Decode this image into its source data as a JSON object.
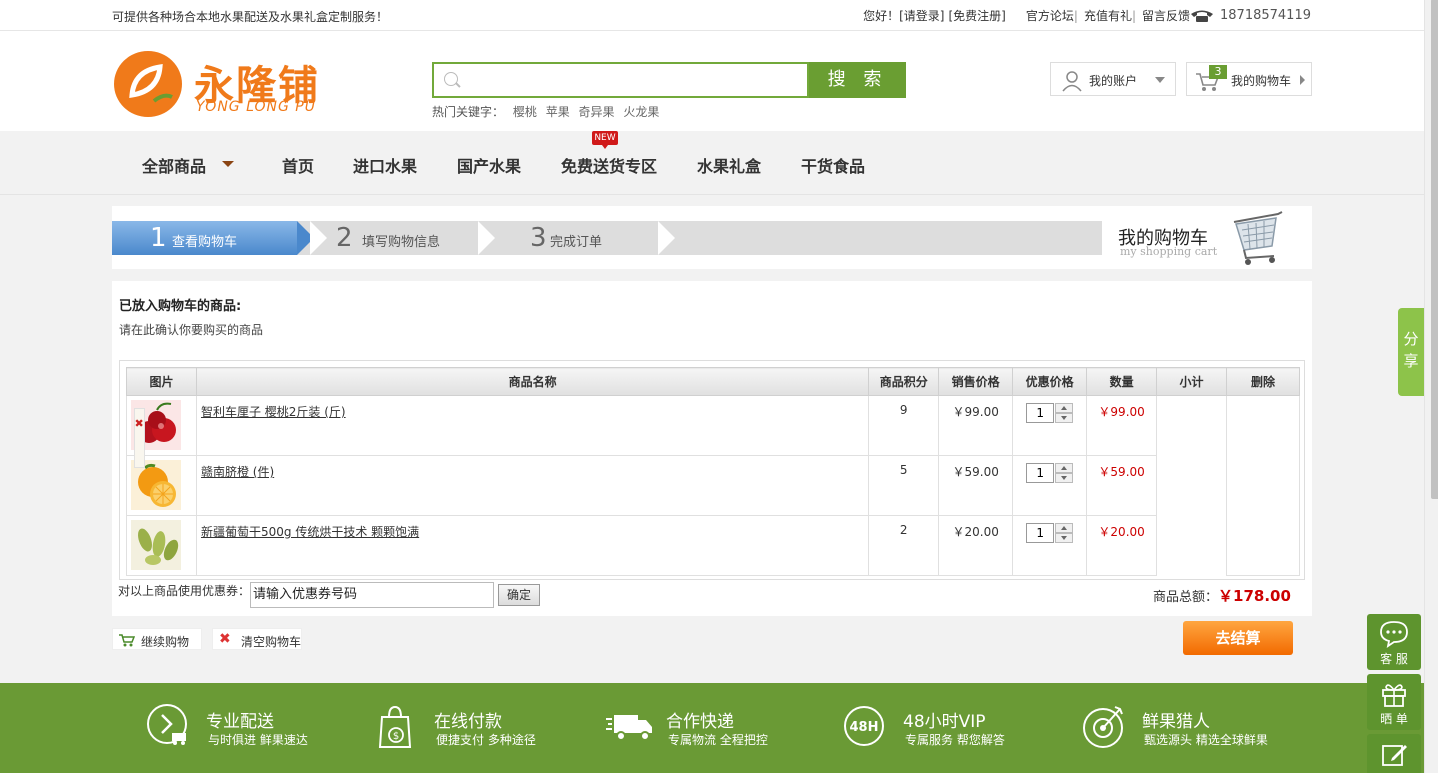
{
  "topbar": {
    "message": "可提供各种场合本地水果配送及水果礼盒定制服务！",
    "greeting": "您好！",
    "login": "[请登录]",
    "register": "[免费注册]",
    "forum": "官方论坛",
    "recharge": "充值有礼",
    "feedback": "留言反馈",
    "phone": "18718574119"
  },
  "logo": {
    "cn": "永隆铺",
    "en": "YONG LONG PU"
  },
  "search": {
    "button": "搜 索",
    "hot_label": "热门关键字：",
    "hot_words": [
      "樱桃",
      "苹果",
      "奇异果",
      "火龙果"
    ]
  },
  "account": {
    "label": "我的账户"
  },
  "cart": {
    "label": "我的购物车",
    "count": "3"
  },
  "nav": {
    "all": "全部商品",
    "items": [
      "首页",
      "进口水果",
      "国产水果",
      "免费送货专区",
      "水果礼盒",
      "干货食品"
    ],
    "new_badge": "NEW"
  },
  "steps": [
    {
      "num": "1",
      "label": "查看购物车"
    },
    {
      "num": "2",
      "label": "填写购物信息"
    },
    {
      "num": "3",
      "label": "完成订单"
    }
  ],
  "mycart": {
    "title": "我的购物车",
    "subtitle": "my shopping cart"
  },
  "content": {
    "heading": "已放入购物车的商品:",
    "subheading": "请在此确认你要购买的商品",
    "columns": [
      "图片",
      "商品名称",
      "商品积分",
      "销售价格",
      "优惠价格",
      "数量",
      "小计",
      "删除"
    ],
    "rows": [
      {
        "name": "智利车厘子 樱桃2斤装 (斤)",
        "points": "9",
        "price": "￥99.00",
        "qty": "1",
        "subtotal": "￥99.00",
        "del": "✖"
      },
      {
        "name": "赣南脐橙 (件)",
        "points": "5",
        "price": "￥59.00",
        "qty": "1",
        "subtotal": "￥59.00",
        "del": "✖"
      },
      {
        "name": "新疆葡萄干500g 传统烘干技术 颗颗饱满",
        "points": "2",
        "price": "￥20.00",
        "qty": "1",
        "subtotal": "￥20.00",
        "del": "✖"
      }
    ],
    "coupon_label": "对以上商品使用优惠券：",
    "coupon_placeholder": "请输入优惠券号码",
    "coupon_button": "确定",
    "total_label": "商品总额：",
    "total_value": "￥178.00"
  },
  "actions": {
    "continue": "继续购物",
    "clear": "清空购物车",
    "checkout": "去结算"
  },
  "features": [
    {
      "title": "专业配送",
      "sub": "与时俱进 鲜果速达",
      "icon": "delivery-icon"
    },
    {
      "title": "在线付款",
      "sub": "便捷支付 多种途径",
      "icon": "payment-icon"
    },
    {
      "title": "合作快递",
      "sub": "专属物流 全程把控",
      "icon": "truck-icon"
    },
    {
      "title": "48小时VIP",
      "sub": "专属服务 帮您解答",
      "icon": "48h-icon"
    },
    {
      "title": "鲜果猎人",
      "sub": "甄选源头 精选全球鲜果",
      "icon": "target-icon"
    }
  ],
  "float": {
    "share": "分享",
    "service": "客 服",
    "show": "晒 单"
  },
  "colors": {
    "brand_green": "#6a9e32",
    "brand_orange": "#f07a1a",
    "price_red": "#cc0000"
  }
}
